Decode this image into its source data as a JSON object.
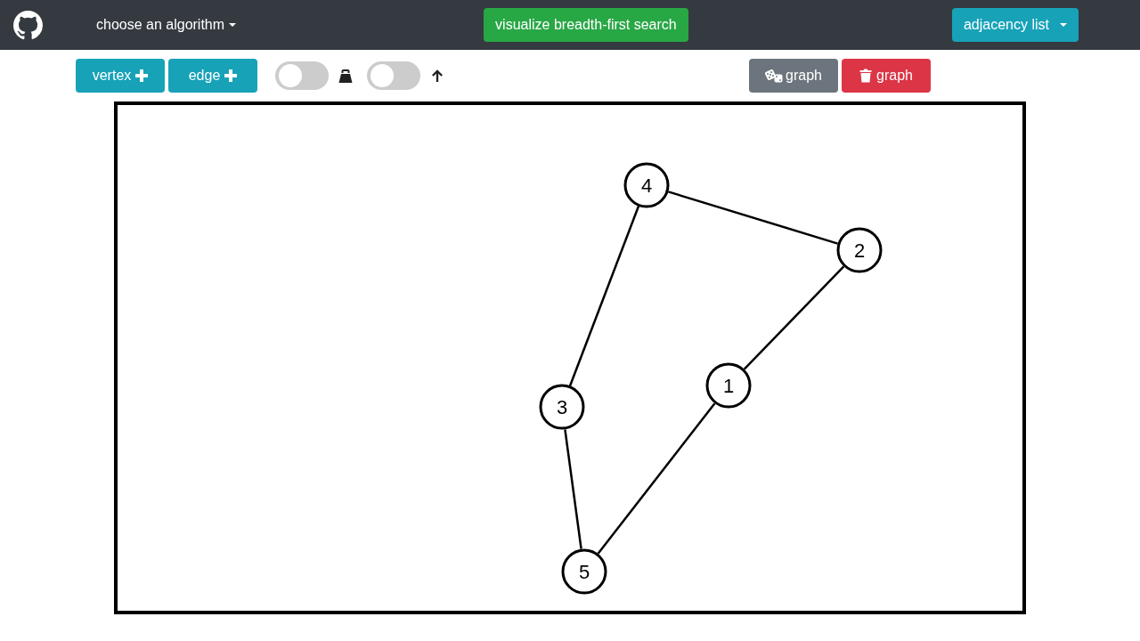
{
  "navbar": {
    "algorithm_menu": {
      "label": "choose an algorithm"
    },
    "visualize_button": {
      "label": "visualize breadth-first search"
    },
    "view_menu": {
      "label": "adjacency list"
    }
  },
  "toolbar": {
    "add_buttons": [
      {
        "label": "vertex"
      },
      {
        "label": "edge"
      }
    ],
    "toggles": [
      {
        "kind": "weighted",
        "on": false
      },
      {
        "kind": "directed",
        "on": false
      }
    ],
    "graph_buttons": [
      {
        "kind": "random",
        "label": "graph"
      },
      {
        "kind": "clear",
        "label": "graph"
      }
    ]
  },
  "graph": {
    "nodes": [
      {
        "label": "4"
      },
      {
        "label": "2"
      },
      {
        "label": "1"
      },
      {
        "label": "3"
      },
      {
        "label": "5"
      }
    ]
  }
}
